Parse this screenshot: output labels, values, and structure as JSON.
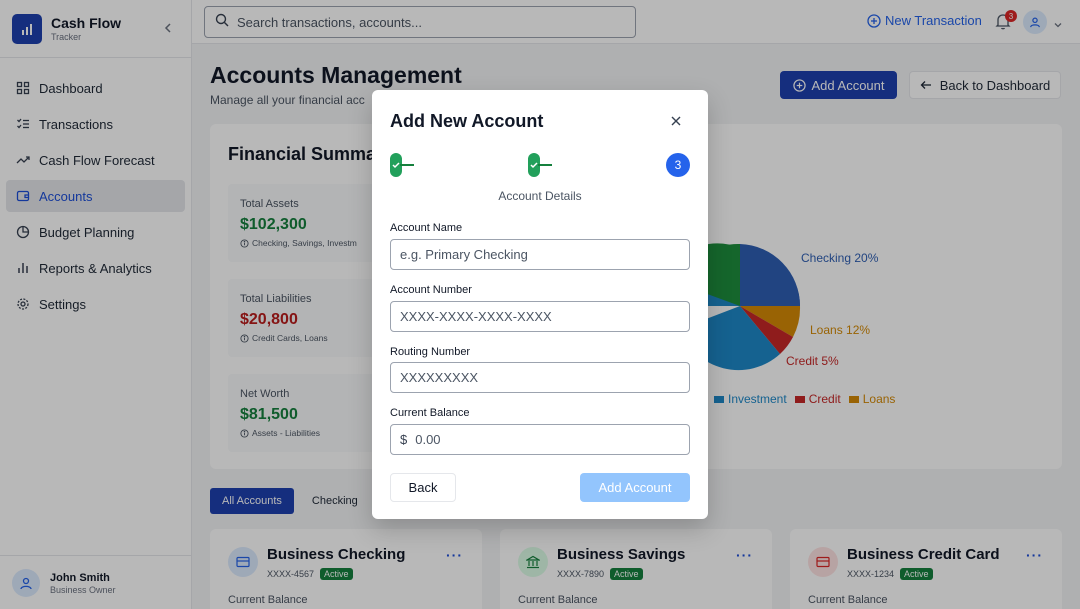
{
  "app": {
    "title": "Cash Flow",
    "subtitle": "Tracker"
  },
  "sidebar": {
    "items": [
      {
        "label": "Dashboard",
        "icon": "grid-icon"
      },
      {
        "label": "Transactions",
        "icon": "list-icon"
      },
      {
        "label": "Cash Flow Forecast",
        "icon": "trend-icon"
      },
      {
        "label": "Accounts",
        "icon": "wallet-icon",
        "active": true
      },
      {
        "label": "Budget Planning",
        "icon": "pie-icon"
      },
      {
        "label": "Reports & Analytics",
        "icon": "bar-chart-icon"
      },
      {
        "label": "Settings",
        "icon": "gear-icon"
      }
    ],
    "user": {
      "name": "John Smith",
      "role": "Business Owner"
    }
  },
  "header": {
    "search_placeholder": "Search transactions, accounts...",
    "new_transaction_label": "New Transaction",
    "notification_count": "3"
  },
  "page": {
    "title": "Accounts Management",
    "subtitle": "Manage all your financial acc",
    "add_account_label": "Add Account",
    "back_label": "Back to Dashboard"
  },
  "summary": {
    "title": "Financial Summa",
    "stats": [
      {
        "label": "Total Assets",
        "value": "$102,300",
        "note": "Checking, Savings, Investm",
        "color": "#15803d"
      },
      {
        "label": "Total Liabilities",
        "value": "$20,800",
        "note": "Credit Cards, Loans",
        "color": "#b91c1c"
      },
      {
        "label": "Net Worth",
        "value": "$81,500",
        "note": "Assets - Liabilities",
        "color": "#15803d"
      }
    ],
    "pie_labels": {
      "checking": "Checking 20%",
      "loans": "Loans 12%",
      "credit": "Credit 5%"
    },
    "legend": [
      {
        "label": "Investment",
        "color": "#1e88c8"
      },
      {
        "label": "Credit",
        "color": "#c62828"
      },
      {
        "label": "Loans",
        "color": "#d48a06"
      }
    ]
  },
  "filters": {
    "tabs": [
      "All Accounts",
      "Checking"
    ]
  },
  "accounts": [
    {
      "name": "Business Checking",
      "number": "XXXX-4567",
      "status": "Active",
      "balance_label": "Current Balance",
      "icon_bg": "#dbeafe",
      "icon": "card-icon"
    },
    {
      "name": "Business Savings",
      "number": "XXXX-7890",
      "status": "Active",
      "balance_label": "Current Balance",
      "icon_bg": "#dcfce7",
      "icon": "bank-icon"
    },
    {
      "name": "Business Credit Card",
      "number": "XXXX-1234",
      "status": "Active",
      "balance_label": "Current Balance",
      "icon_bg": "#fee2e2",
      "icon": "credit-card-icon"
    }
  ],
  "modal": {
    "title": "Add New Account",
    "current_step": "3",
    "step_label": "Account Details",
    "fields": {
      "name_label": "Account Name",
      "name_placeholder": "e.g. Primary Checking",
      "number_label": "Account Number",
      "number_placeholder": "XXXX-XXXX-XXXX-XXXX",
      "routing_label": "Routing Number",
      "routing_placeholder": "XXXXXXXXX",
      "balance_label": "Current Balance",
      "balance_prefix": "$",
      "balance_placeholder": "0.00"
    },
    "back_label": "Back",
    "submit_label": "Add Account"
  }
}
